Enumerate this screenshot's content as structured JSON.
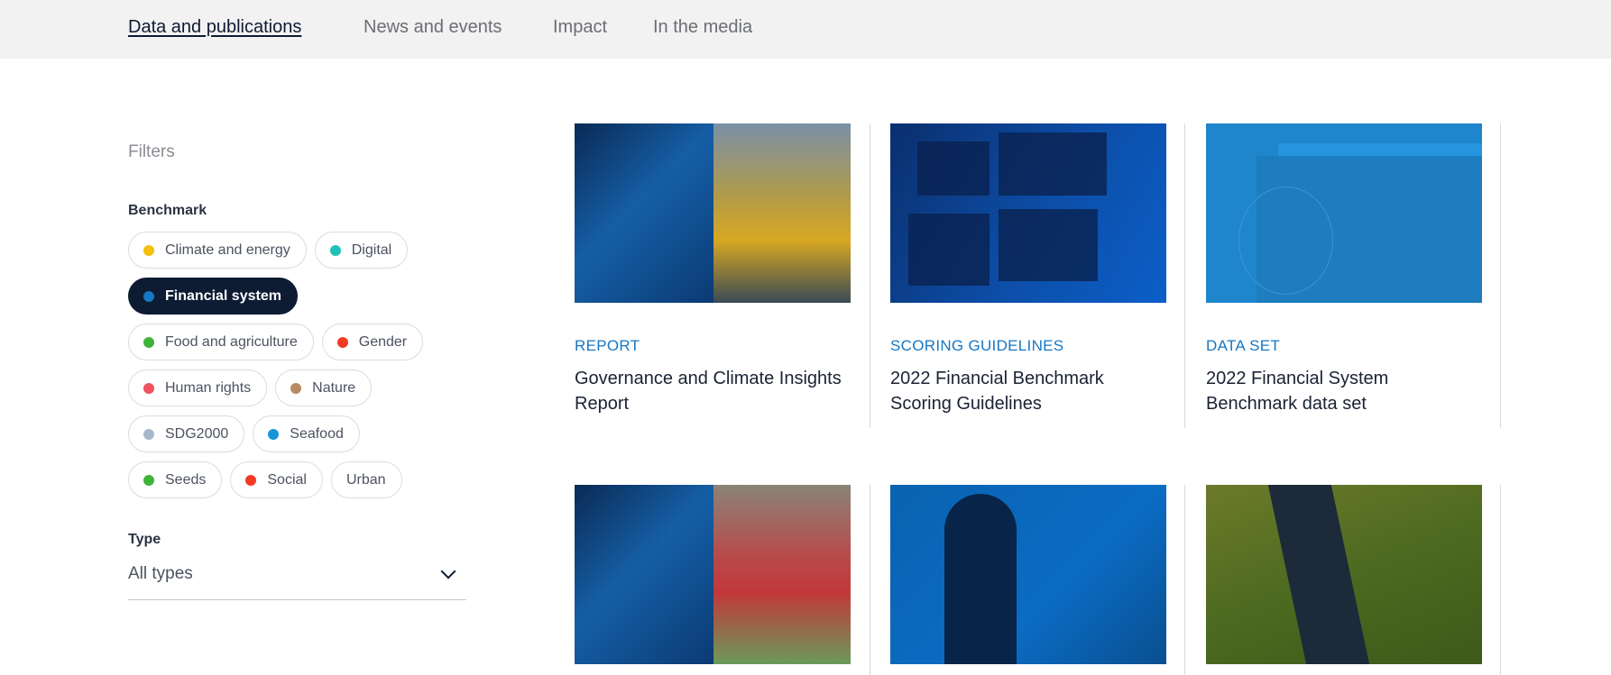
{
  "nav": {
    "items": [
      {
        "label": "Data and publications",
        "active": true
      },
      {
        "label": "News and events",
        "active": false
      },
      {
        "label": "Impact",
        "active": false
      },
      {
        "label": "In the media",
        "active": false
      }
    ]
  },
  "filters": {
    "title": "Filters",
    "benchmark_label": "Benchmark",
    "benchmarks": [
      {
        "label": "Climate and energy",
        "color": "#f5bf0a",
        "selected": false
      },
      {
        "label": "Digital",
        "color": "#1fc2b5",
        "selected": false
      },
      {
        "label": "Financial system",
        "color": "#1677c4",
        "selected": true
      },
      {
        "label": "Food and agriculture",
        "color": "#3fb23a",
        "selected": false
      },
      {
        "label": "Gender",
        "color": "#f23a24",
        "selected": false
      },
      {
        "label": "Human rights",
        "color": "#f0525e",
        "selected": false
      },
      {
        "label": "Nature",
        "color": "#b88b62",
        "selected": false
      },
      {
        "label": "SDG2000",
        "color": "#a9b7cc",
        "selected": false
      },
      {
        "label": "Seafood",
        "color": "#1696d8",
        "selected": false
      },
      {
        "label": "Seeds",
        "color": "#3fb23a",
        "selected": false
      },
      {
        "label": "Social",
        "color": "#f23a24",
        "selected": false
      },
      {
        "label": "Urban",
        "color": null,
        "selected": false
      }
    ],
    "type_label": "Type",
    "type_value": "All types"
  },
  "cards": [
    {
      "type": "REPORT",
      "title": "Governance and Climate Insights Report"
    },
    {
      "type": "SCORING GUIDELINES",
      "title": "2022 Financial Benchmark Scoring Guidelines"
    },
    {
      "type": "DATA SET",
      "title": "2022 Financial System Benchmark data set"
    },
    {
      "type": "",
      "title": ""
    },
    {
      "type": "",
      "title": ""
    },
    {
      "type": "",
      "title": ""
    }
  ],
  "colors": {
    "accent": "#1677c4",
    "selected_chip": "#0d1b33"
  }
}
